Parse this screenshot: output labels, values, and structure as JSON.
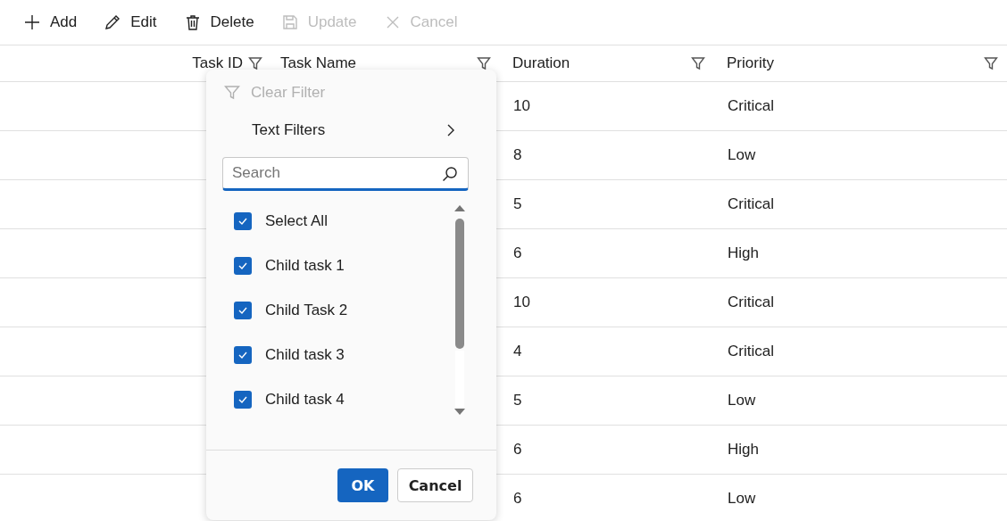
{
  "toolbar": [
    {
      "kind": "add",
      "label": "Add",
      "disabled": false
    },
    {
      "kind": "edit",
      "label": "Edit",
      "disabled": false
    },
    {
      "kind": "delete",
      "label": "Delete",
      "disabled": false
    },
    {
      "kind": "update",
      "label": "Update",
      "disabled": true
    },
    {
      "kind": "cancel",
      "label": "Cancel",
      "disabled": true
    }
  ],
  "columns": [
    {
      "title": "Task ID"
    },
    {
      "title": "Task Name"
    },
    {
      "title": "Duration"
    },
    {
      "title": "Priority"
    }
  ],
  "rows": [
    {
      "duration": "10",
      "priority": "Critical"
    },
    {
      "duration": "8",
      "priority": "Low"
    },
    {
      "duration": "5",
      "priority": "Critical"
    },
    {
      "duration": "6",
      "priority": "High"
    },
    {
      "duration": "10",
      "priority": "Critical"
    },
    {
      "duration": "4",
      "priority": "Critical"
    },
    {
      "duration": "5",
      "priority": "Low"
    },
    {
      "duration": "6",
      "priority": "High"
    },
    {
      "duration": "6",
      "priority": "Low"
    }
  ],
  "filter_menu": {
    "clear_filter": {
      "label": "Clear Filter",
      "disabled": true
    },
    "text_filters": "Text Filters",
    "search": {
      "placeholder": "Search"
    },
    "items": [
      {
        "label": "Select All",
        "checked": true
      },
      {
        "label": "Child task 1",
        "checked": true
      },
      {
        "label": "Child Task 2",
        "checked": true
      },
      {
        "label": "Child task 3",
        "checked": true
      },
      {
        "label": "Child task 4",
        "checked": true
      }
    ],
    "buttons": [
      {
        "kind": "primary",
        "label": "OK"
      },
      {
        "kind": "secondary",
        "label": "Cancel"
      }
    ]
  }
}
